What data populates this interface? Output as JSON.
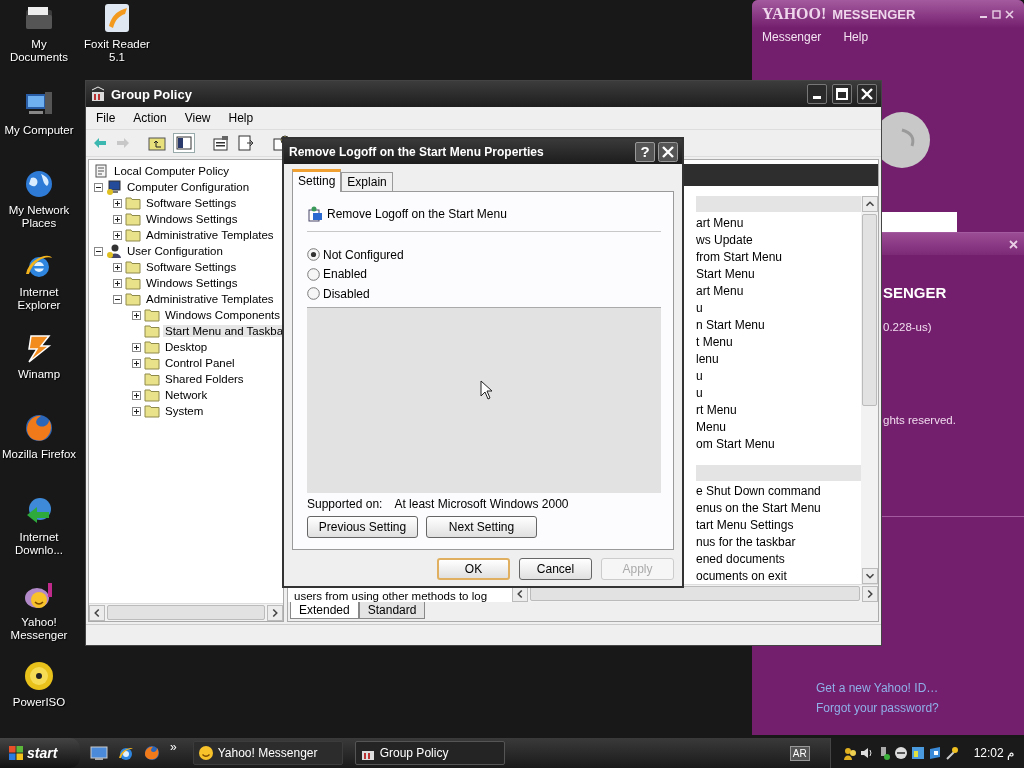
{
  "desktop_icons": [
    "My Documents",
    "Foxit Reader 5.1",
    "My Computer",
    "My Network Places",
    "Internet Explorer",
    "Winamp",
    "Mozilla Firefox",
    "Internet Downlo...",
    "Yahoo! Messenger",
    "PowerISO"
  ],
  "messenger_window": {
    "logo": "YAHOO!",
    "title": "MESSENGER",
    "menu": [
      "Messenger",
      "Help"
    ],
    "links": [
      "Get a new Yahoo! ID…",
      "Forgot your password?"
    ]
  },
  "messenger_popup": {
    "texts": [
      "SENGER",
      "0.228-us)",
      "ghts reserved."
    ]
  },
  "group_policy": {
    "title": "Group Policy",
    "menu": [
      "File",
      "Action",
      "View",
      "Help"
    ],
    "tree_root": "Local Computer Policy",
    "tree": [
      {
        "label": "Computer Configuration",
        "expanded": true,
        "selected": false,
        "children": [
          {
            "label": "Software Settings",
            "expanded": false,
            "selected": false
          },
          {
            "label": "Windows Settings",
            "expanded": false,
            "selected": false
          },
          {
            "label": "Administrative Templates",
            "expanded": false,
            "selected": false
          }
        ]
      },
      {
        "label": "User Configuration",
        "expanded": true,
        "selected": false,
        "children": [
          {
            "label": "Software Settings",
            "expanded": false,
            "selected": false
          },
          {
            "label": "Windows Settings",
            "expanded": false,
            "selected": false
          },
          {
            "label": "Administrative Templates",
            "expanded": true,
            "selected": false,
            "children": [
              {
                "label": "Windows Components",
                "expanded": false,
                "selected": false
              },
              {
                "label": "Start Menu and Taskba",
                "selected": true
              },
              {
                "label": "Desktop",
                "expanded": false,
                "selected": false
              },
              {
                "label": "Control Panel",
                "expanded": false,
                "selected": false
              },
              {
                "label": "Shared Folders",
                "selected": false
              },
              {
                "label": "Network",
                "expanded": false,
                "selected": false
              },
              {
                "label": "System",
                "expanded": false,
                "selected": false
              }
            ]
          }
        ]
      }
    ],
    "description": "users from using other methods to log",
    "list_groups": [
      [
        "art Menu",
        "ws Update",
        "from Start Menu",
        "Start Menu",
        "art Menu",
        "u",
        "n Start Menu",
        "t Menu",
        "lenu",
        "u",
        "u",
        "rt Menu",
        "Menu",
        "om Start Menu"
      ],
      [
        "e Shut Down command",
        "enus on the Start Menu",
        "tart Menu Settings",
        "nus for the taskbar",
        "ened documents",
        "ocuments on exit"
      ]
    ],
    "view_tabs": [
      {
        "label": "Extended",
        "selected": true
      },
      {
        "label": "Standard",
        "selected": false
      }
    ]
  },
  "dialog": {
    "title": "Remove Logoff on the Start Menu Properties",
    "help_button": "?",
    "tabs": [
      {
        "label": "Setting",
        "selected": true
      },
      {
        "label": "Explain",
        "selected": false
      }
    ],
    "policy_name": "Remove Logoff on the Start Menu",
    "options": [
      {
        "label": "Not Configured",
        "selected": true
      },
      {
        "label": "Enabled",
        "selected": false
      },
      {
        "label": "Disabled",
        "selected": false
      }
    ],
    "supported_label": "Supported on:",
    "supported_value": "At least Microsoft Windows 2000",
    "nav_buttons": [
      "Previous Setting",
      "Next Setting"
    ],
    "buttons": [
      {
        "label": "OK",
        "default": true,
        "disabled": false
      },
      {
        "label": "Cancel",
        "default": false,
        "disabled": false
      },
      {
        "label": "Apply",
        "default": false,
        "disabled": true
      }
    ]
  },
  "taskbar": {
    "start": "start",
    "chevron": "»",
    "tasks": [
      {
        "label": "Yahoo! Messenger",
        "selected": false
      },
      {
        "label": "Group Policy",
        "selected": true
      }
    ],
    "language": "AR",
    "clock": "12:02 م"
  }
}
